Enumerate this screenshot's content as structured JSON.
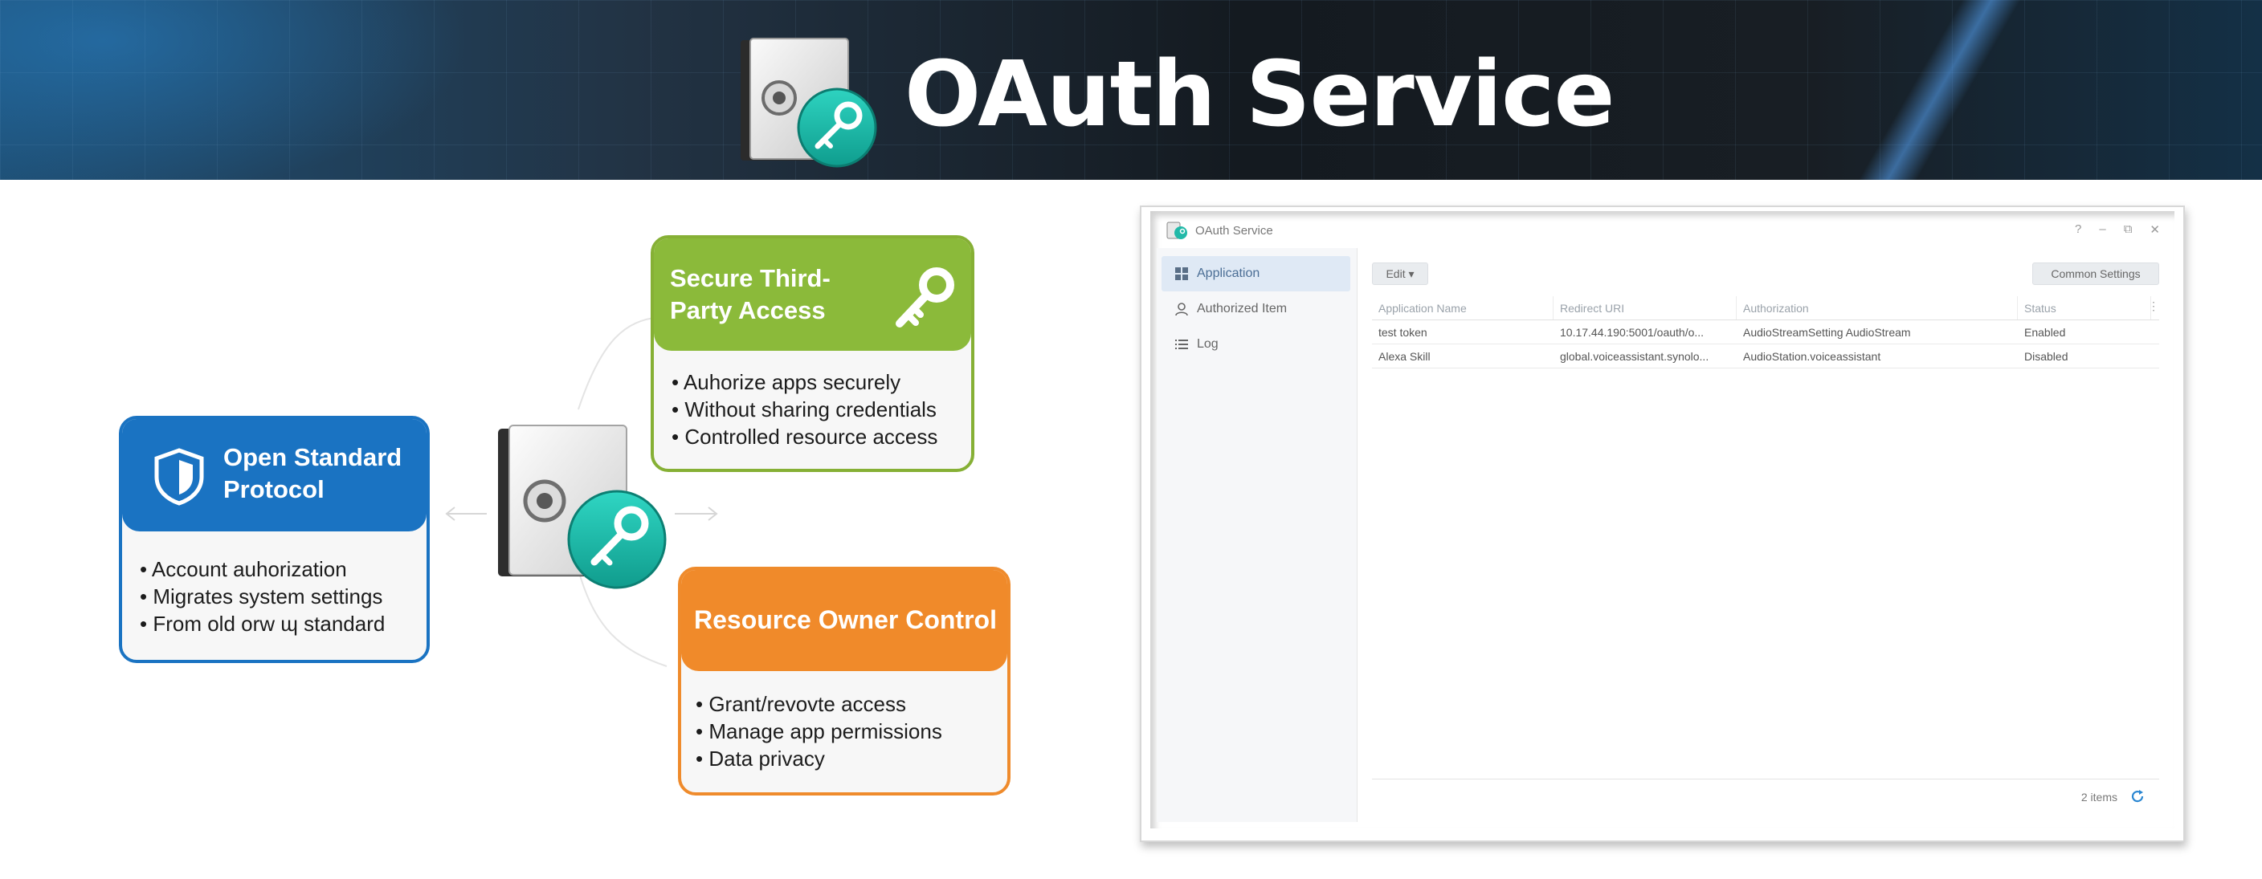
{
  "banner": {
    "title": "OAuth Service"
  },
  "cards": {
    "open_standard": {
      "title_line1": "Open Standard",
      "title_line2": "Protocol",
      "bullets": [
        "Account auhorization",
        "Migrates system settings",
        "From old orw ɰ standard"
      ],
      "color": "#1a73c2"
    },
    "third_party": {
      "title_line1": "Secure Third-",
      "title_line2": "Party Access",
      "bullets": [
        "Auhorize apps securely",
        "Without sharing credentials",
        "Controlled resource access"
      ],
      "color": "#8bba3a"
    },
    "owner_control": {
      "title": "Resource Owner Control",
      "bullets": [
        "Grant/revovte access",
        "Manage app permissions",
        "Data privacy"
      ],
      "color": "#f08a2a"
    }
  },
  "window": {
    "title": "OAuth Service",
    "controls": [
      "?",
      "–",
      "⧉",
      "✕"
    ],
    "sidebar": [
      {
        "label": "Application",
        "icon": "grid-icon",
        "active": true
      },
      {
        "label": "Authorized Item",
        "icon": "user-icon",
        "active": false
      },
      {
        "label": "Log",
        "icon": "list-icon",
        "active": false
      }
    ],
    "toolbar": {
      "edit_label": "Edit ▾",
      "common_label": "Common Settings"
    },
    "columns": [
      "Application Name",
      "Redirect URI",
      "Authorization",
      "Status"
    ],
    "more_glyph": "⋮",
    "rows": [
      [
        "test token",
        "10.17.44.190:5001/oauth/o...",
        "AudioStreamSetting AudioStream",
        "Enabled"
      ],
      [
        "Alexa Skill",
        "global.voiceassistant.synolo...",
        "AudioStation.voiceassistant",
        "Disabled"
      ]
    ],
    "footer": {
      "count": "2 items"
    }
  }
}
